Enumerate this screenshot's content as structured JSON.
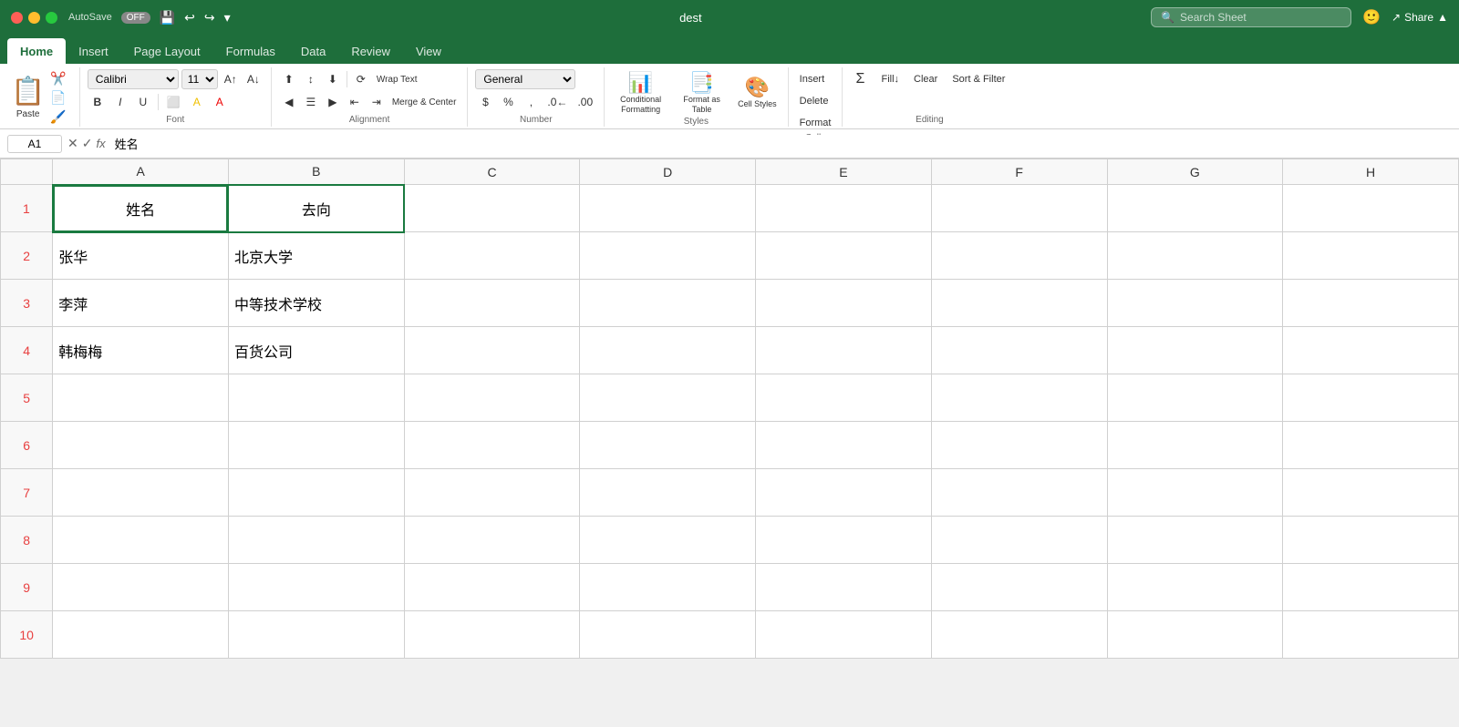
{
  "titleBar": {
    "title": "dest",
    "autosave": "AutoSave",
    "autosaveState": "OFF",
    "searchPlaceholder": "Search Sheet",
    "shareLabel": "Share"
  },
  "ribbon": {
    "tabs": [
      "Home",
      "Insert",
      "Page Layout",
      "Formulas",
      "Data",
      "Review",
      "View"
    ],
    "activeTab": "Home",
    "groups": {
      "clipboard": {
        "label": "Paste"
      },
      "font": {
        "label": "Font",
        "fontName": "Calibri",
        "fontSize": "11",
        "boldLabel": "B",
        "italicLabel": "I",
        "underlineLabel": "U"
      },
      "alignment": {
        "label": "Alignment",
        "wrapText": "Wrap Text",
        "mergeCenter": "Merge & Center"
      },
      "number": {
        "label": "Number",
        "format": "General"
      },
      "styles": {
        "conditionalFormatting": "Conditional Formatting",
        "formatAsTable": "Format as Table",
        "cellStyles": "Cell Styles"
      },
      "cells": {
        "insert": "Insert",
        "delete": "Delete",
        "format": "Format"
      },
      "editing": {
        "autoSum": "Σ",
        "sortFilter": "Sort & Filter"
      }
    }
  },
  "formulaBar": {
    "cellRef": "A1",
    "formula": "姓名"
  },
  "spreadsheet": {
    "columns": [
      "A",
      "B",
      "C",
      "D",
      "E",
      "F",
      "G",
      "H"
    ],
    "rows": [
      {
        "rowNum": "1",
        "cells": [
          "姓名",
          "去向",
          "",
          "",
          "",
          "",
          "",
          ""
        ]
      },
      {
        "rowNum": "2",
        "cells": [
          "张华",
          "北京大学",
          "",
          "",
          "",
          "",
          "",
          ""
        ]
      },
      {
        "rowNum": "3",
        "cells": [
          "李萍",
          "中等技术学校",
          "",
          "",
          "",
          "",
          "",
          ""
        ]
      },
      {
        "rowNum": "4",
        "cells": [
          "韩梅梅",
          "百货公司",
          "",
          "",
          "",
          "",
          "",
          ""
        ]
      },
      {
        "rowNum": "5",
        "cells": [
          "",
          "",
          "",
          "",
          "",
          "",
          "",
          ""
        ]
      },
      {
        "rowNum": "6",
        "cells": [
          "",
          "",
          "",
          "",
          "",
          "",
          "",
          ""
        ]
      },
      {
        "rowNum": "7",
        "cells": [
          "",
          "",
          "",
          "",
          "",
          "",
          "",
          ""
        ]
      },
      {
        "rowNum": "8",
        "cells": [
          "",
          "",
          "",
          "",
          "",
          "",
          "",
          ""
        ]
      },
      {
        "rowNum": "9",
        "cells": [
          "",
          "",
          "",
          "",
          "",
          "",
          "",
          ""
        ]
      },
      {
        "rowNum": "10",
        "cells": [
          "",
          "",
          "",
          "",
          "",
          "",
          "",
          ""
        ]
      }
    ]
  }
}
